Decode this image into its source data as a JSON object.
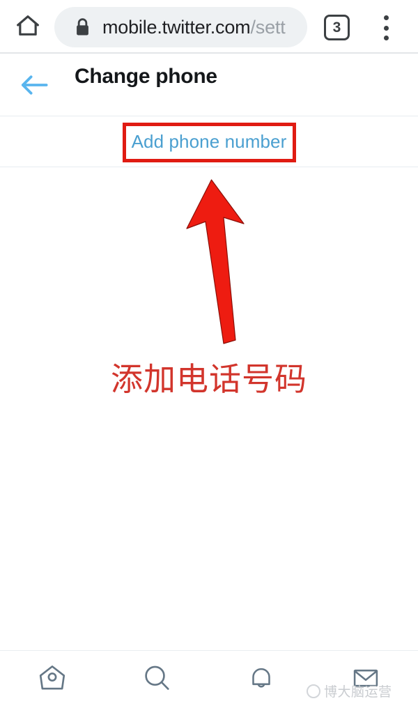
{
  "browser": {
    "home_icon": "home-icon",
    "lock_icon": "lock-icon",
    "url_host": "mobile.twitter.com",
    "url_path": "/sett",
    "tab_count": "3",
    "overflow_icon": "overflow-menu-icon"
  },
  "page": {
    "back_icon": "back-arrow-icon",
    "title": "Change phone",
    "add_phone_label": "Add phone number"
  },
  "bottom_nav": {
    "items": [
      {
        "label": "Home",
        "icon": "home-icon"
      },
      {
        "label": "Search",
        "icon": "search-icon"
      },
      {
        "label": "Notifications",
        "icon": "bell-icon"
      },
      {
        "label": "Messages",
        "icon": "envelope-icon"
      }
    ]
  },
  "annotations": {
    "highlight_color": "#e01b12",
    "arrow_color": "#ee1c11",
    "caption": "添加电话号码",
    "caption_color": "#d2352c"
  },
  "watermark": {
    "text": "博大脑运营"
  }
}
